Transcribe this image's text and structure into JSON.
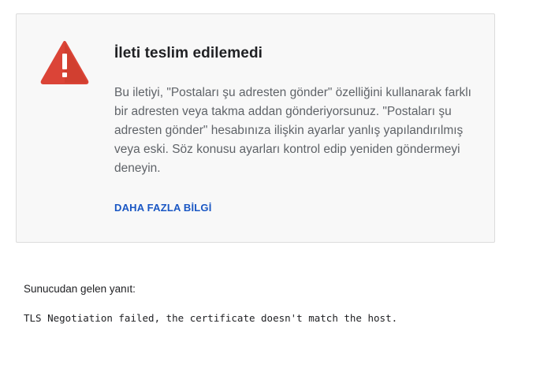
{
  "message": {
    "icon": "warning-triangle-icon",
    "title": "İleti teslim edilemedi",
    "body": "Bu iletiyi, \"Postaları şu adresten gönder\" özelliğini kullanarak farklı bir adresten veya takma addan gönderiyorsunuz. \"Postaları şu adresten gönder\" hesabınıza ilişkin ayarlar yanlış yapılandırılmış veya eski. Söz konusu ayarları kontrol edip yeniden göndermeyi deneyin.",
    "learn_more": "DAHA FAZLA BİLGİ"
  },
  "server_response": {
    "label": "Sunucudan gelen yanıt:",
    "text": "TLS Negotiation failed, the certificate doesn't match the host."
  },
  "colors": {
    "warning": "#db4437",
    "link": "#1a57c4",
    "card_background": "#f8f8f8"
  }
}
